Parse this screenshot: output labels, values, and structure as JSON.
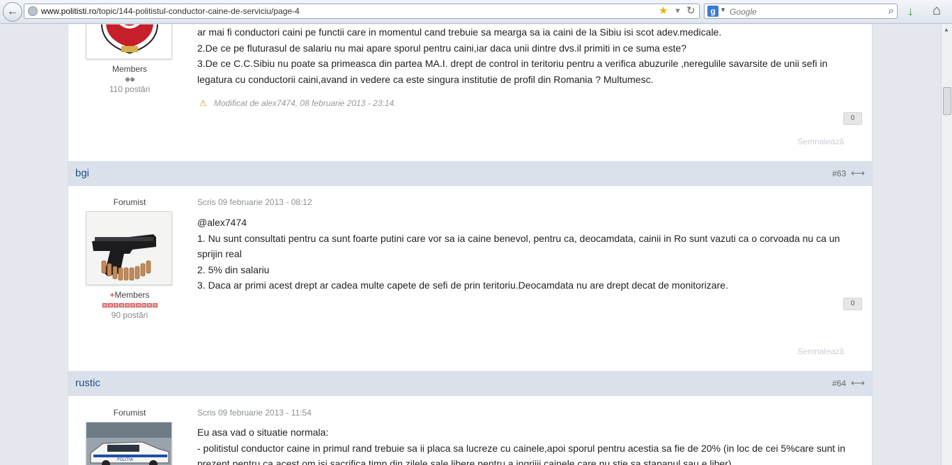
{
  "browser": {
    "url_host": "www.politisti.ro",
    "url_path": "/topic/144-politistul-conductor-caine-de-serviciu/page-4",
    "search_placeholder": "Google"
  },
  "post_prev": {
    "role": "Members",
    "posts": "110 postări",
    "lines": [
      "ar mai fi conductori caini pe functii care in momentul cand trebuie sa mearga sa ia caini de la Sibiu isi scot adev.medicale.",
      "2.De ce pe fluturasul de salariu nu mai apare sporul pentru caini,iar daca unii dintre dvs.il primiti in ce suma este?",
      "3.De ce C.C.Sibiu nu poate sa primeasca din partea MA.I. drept de control in teritoriu pentru a verifica abuzurile ,neregulile savarsite de unii sefi in legatura cu conductorii caini,avand in vedere ca este singura institutie de profil din Romania ? Multumesc."
    ],
    "edit_note": "Modificat de alex7474, 08 februarie 2013 - 23:14.",
    "reputation": "0",
    "report_label": "Semnalează"
  },
  "post_63": {
    "author": "bgi",
    "number": "#63",
    "role": "Forumist",
    "group": "Members",
    "group_prefix": "+",
    "posts": "90 postări",
    "date": "Scris 09 februarie 2013 - 08:12",
    "lines": [
      "@alex7474",
      "1. Nu sunt consultati pentru ca sunt foarte putini care vor sa ia caine benevol, pentru ca, deocamdata, cainii in Ro sunt vazuti ca o corvoada nu ca un sprijin real",
      "2. 5% din salariu",
      "3. Daca ar primi acest drept ar cadea multe capete de sefi de prin teritoriu.Deocamdata nu are drept decat de monitorizare."
    ],
    "reputation": "0",
    "report_label": "Semnalează"
  },
  "post_64": {
    "author": "rustic",
    "number": "#64",
    "role": "Forumist",
    "date": "Scris 09 februarie 2013 - 11:54",
    "lines": [
      "Eu asa vad o situatie normala:",
      "- politistul conductor caine in primul rand trebuie sa ii placa sa lucreze cu cainele,apoi sporul pentru acestia sa fie de 20% (in loc de cei 5%care sunt in",
      "prezent pentru ca acest om isi sacrifica timp din zilele sale libere pentru a ingrijii cainele care nu stie sa stapanul sau e liber)"
    ]
  },
  "icons": {
    "back": "back-arrow-icon",
    "share": "share-icon",
    "warning": "warning-icon"
  },
  "colors": {
    "header_bg": "#dbe1ea",
    "username": "#1f5190",
    "page_bg": "#e4e8ee"
  }
}
